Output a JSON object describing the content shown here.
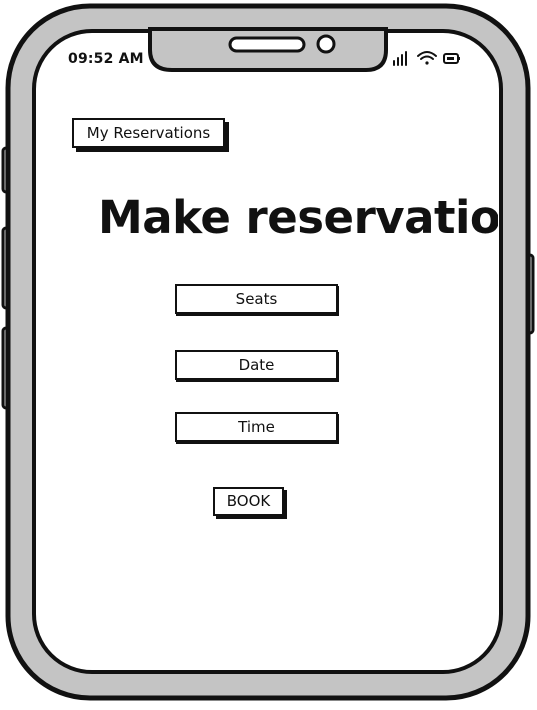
{
  "status_bar": {
    "time": "09:52 AM",
    "icons": [
      "signal-icon",
      "wifi-icon",
      "battery-icon"
    ]
  },
  "nav": {
    "my_reservations_label": "My Reservations"
  },
  "page": {
    "title": "Make reservation"
  },
  "form": {
    "seats_placeholder": "Seats",
    "date_placeholder": "Date",
    "time_placeholder": "Time",
    "book_label": "BOOK"
  },
  "colors": {
    "ink": "#111111",
    "frame_gray": "#c4c4c4",
    "screen": "#ffffff"
  }
}
